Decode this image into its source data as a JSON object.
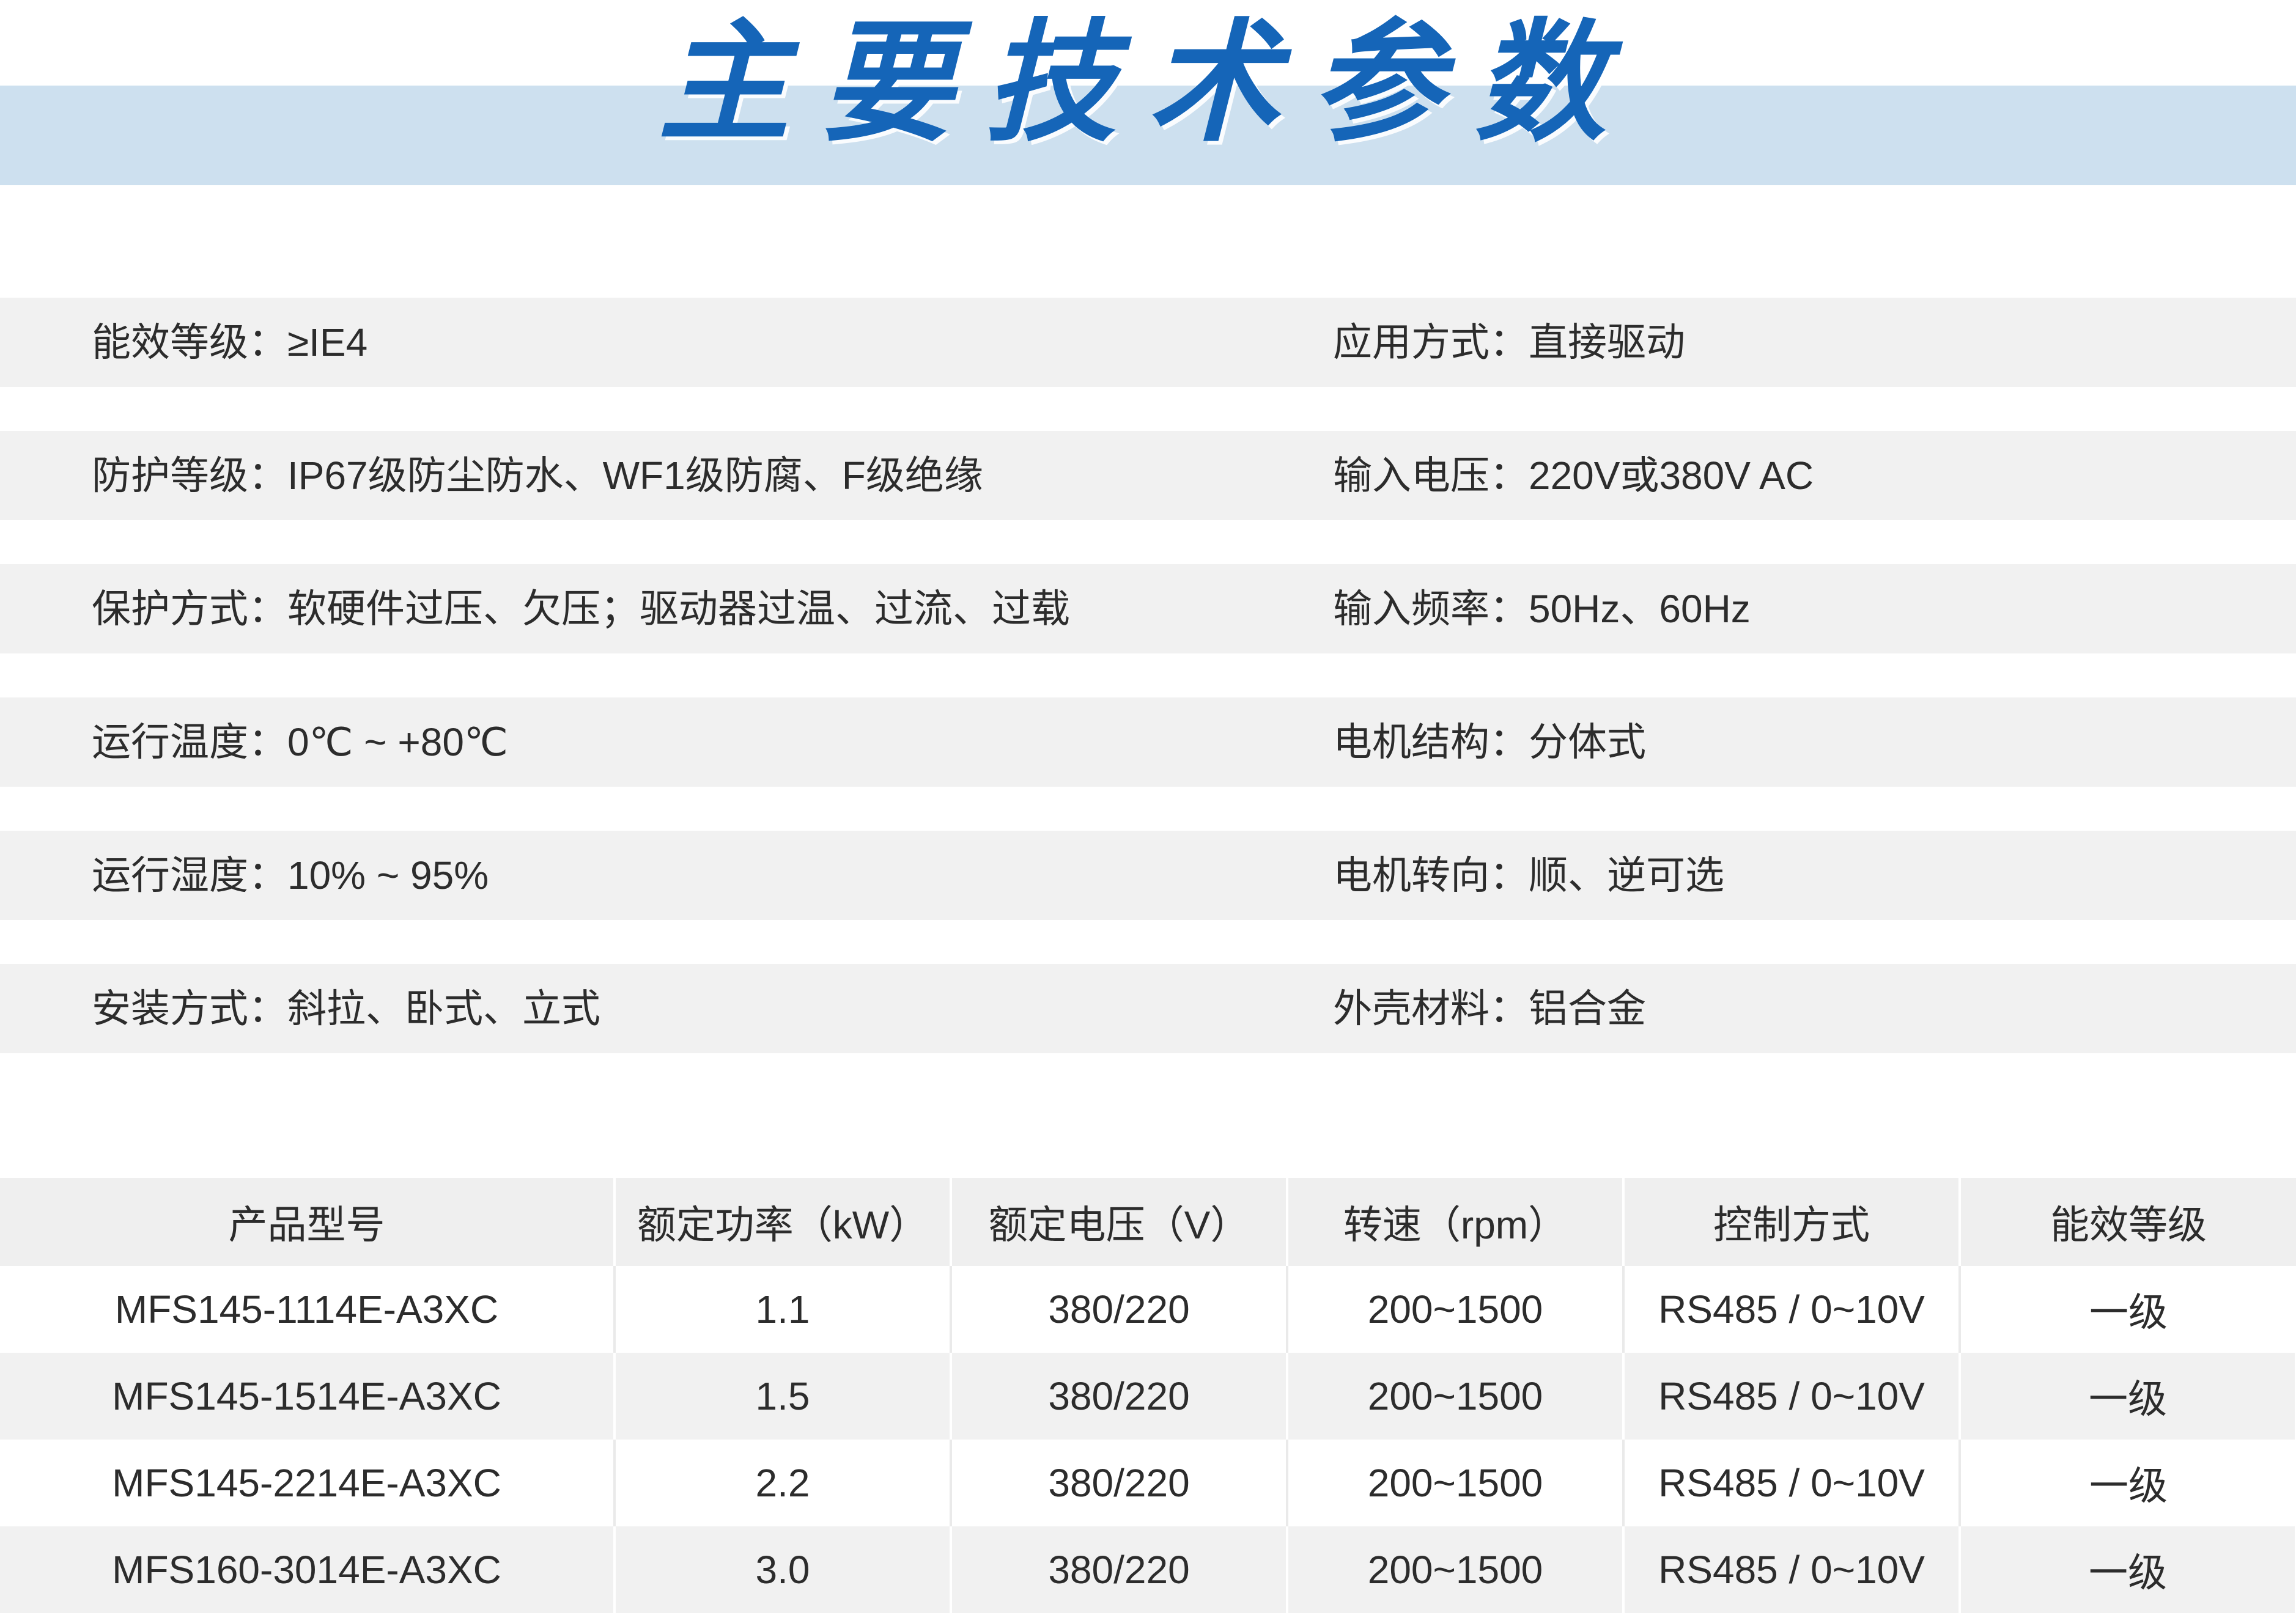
{
  "title": "主要技术参数",
  "specs": {
    "rows": [
      {
        "left": "能效等级：≥IE4",
        "right": "应用方式：直接驱动"
      },
      {
        "left": "防护等级：IP67级防尘防水、WF1级防腐、F级绝缘",
        "right": "输入电压：220V或380V AC"
      },
      {
        "left": "保护方式：软硬件过压、欠压；驱动器过温、过流、过载",
        "right": "输入频率：50Hz、60Hz"
      },
      {
        "left": "运行温度：0℃ ~ +80℃",
        "right": "电机结构：分体式"
      },
      {
        "left": "运行湿度：10% ~ 95%",
        "right": "电机转向：顺、逆可选"
      },
      {
        "left": "安装方式：斜拉、卧式、立式",
        "right": "外壳材料：铝合金"
      }
    ]
  },
  "table": {
    "headers": [
      "产品型号",
      "额定功率（kW）",
      "额定电压（V）",
      "转速（rpm）",
      "控制方式",
      "能效等级"
    ],
    "rows": [
      [
        "MFS145-1114E-A3XC",
        "1.1",
        "380/220",
        "200~1500",
        "RS485 / 0~10V",
        "一级"
      ],
      [
        "MFS145-1514E-A3XC",
        "1.5",
        "380/220",
        "200~1500",
        "RS485 / 0~10V",
        "一级"
      ],
      [
        "MFS145-2214E-A3XC",
        "2.2",
        "380/220",
        "200~1500",
        "RS485 / 0~10V",
        "一级"
      ],
      [
        "MFS160-3014E-A3XC",
        "3.0",
        "380/220",
        "200~1500",
        "RS485 / 0~10V",
        "一级"
      ]
    ]
  }
}
